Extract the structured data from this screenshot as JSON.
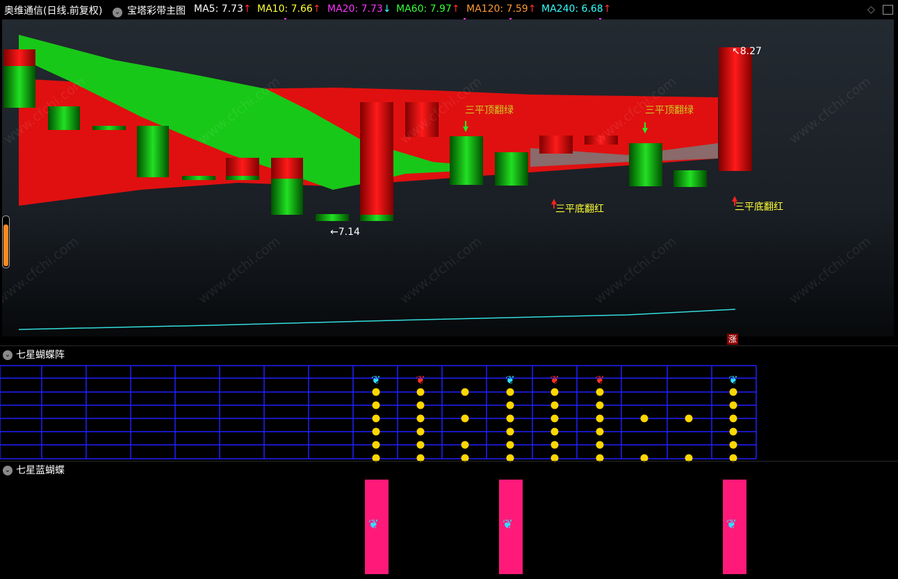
{
  "header": {
    "stock_title": "奥维通信(日线.前复权)",
    "indicator_name": "宝塔彩带主图",
    "ma": [
      {
        "label": "MA5: 7.73",
        "arrow": "↑",
        "color": "#ffffff",
        "arrow_color": "#ff3030"
      },
      {
        "label": "MA10: 7.66",
        "arrow": "↑",
        "color": "#ffff33",
        "arrow_color": "#ff3030"
      },
      {
        "label": "MA20: 7.73",
        "arrow": "↓",
        "color": "#ff33ff",
        "arrow_color": "#33ffff"
      },
      {
        "label": "MA60: 7.97",
        "arrow": "↑",
        "color": "#33ff33",
        "arrow_color": "#ff3030"
      },
      {
        "label": "MA120: 7.59",
        "arrow": "↑",
        "color": "#ff9933",
        "arrow_color": "#ff3030"
      },
      {
        "label": "MA240: 6.68",
        "arrow": "↑",
        "color": "#33ffff",
        "arrow_color": "#ff3030"
      }
    ]
  },
  "main_chart": {
    "high_label": "8.27",
    "low_label": "7.14",
    "top_signal": "三平顶翻绿",
    "bottom_signal": "三平底翻红",
    "rise_badge": "涨",
    "watermark": "www.cfchi.com"
  },
  "panel1": {
    "title": "七星蝴蝶阵"
  },
  "panel2": {
    "title": "七星蓝蝴蝶"
  },
  "colors": {
    "up": "#ff1010",
    "down": "#10c010",
    "grid": "#1a1aff",
    "dot": "#ffd700",
    "pink": "#ff1a7a"
  }
}
